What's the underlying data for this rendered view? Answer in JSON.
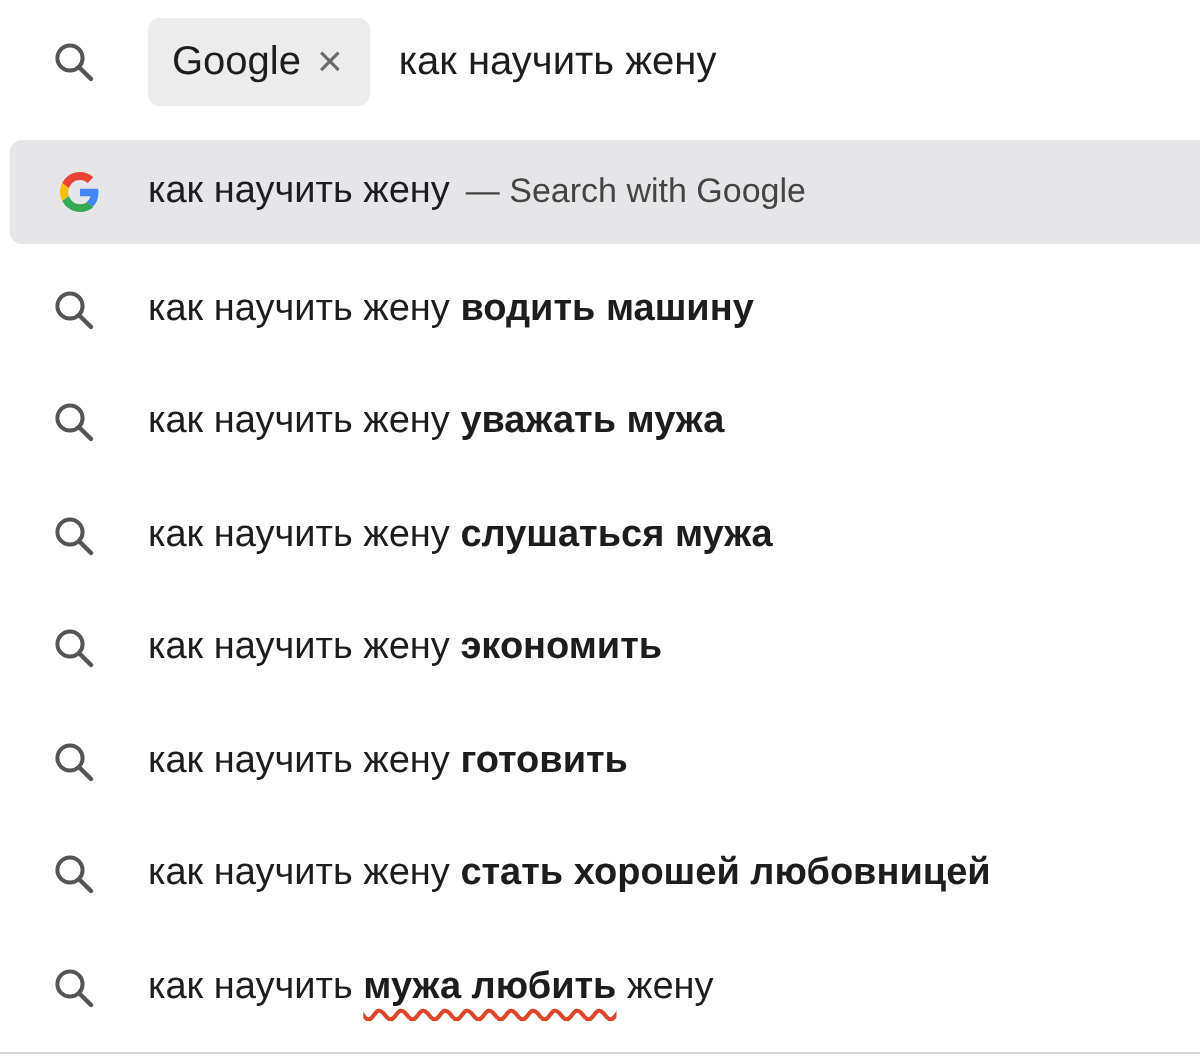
{
  "search_bar": {
    "engine_chip": {
      "label": "Google",
      "remove": "×"
    },
    "query": "как научить жену"
  },
  "suggestions": [
    {
      "kind": "engine",
      "selected": true,
      "parts": [
        {
          "text": "как научить жену",
          "bold": false,
          "misspelled": false
        }
      ],
      "suffix": "— Search with Google"
    },
    {
      "kind": "search",
      "selected": false,
      "parts": [
        {
          "text": "как научить жену ",
          "bold": false,
          "misspelled": false
        },
        {
          "text": "водить машину",
          "bold": true,
          "misspelled": false
        }
      ]
    },
    {
      "kind": "search",
      "selected": false,
      "parts": [
        {
          "text": "как научить жену ",
          "bold": false,
          "misspelled": false
        },
        {
          "text": "уважать мужа",
          "bold": true,
          "misspelled": false
        }
      ]
    },
    {
      "kind": "search",
      "selected": false,
      "parts": [
        {
          "text": "как научить жену ",
          "bold": false,
          "misspelled": false
        },
        {
          "text": "слушаться мужа",
          "bold": true,
          "misspelled": false
        }
      ]
    },
    {
      "kind": "search",
      "selected": false,
      "parts": [
        {
          "text": "как научить жену ",
          "bold": false,
          "misspelled": false
        },
        {
          "text": "экономить",
          "bold": true,
          "misspelled": false
        }
      ]
    },
    {
      "kind": "search",
      "selected": false,
      "parts": [
        {
          "text": "как научить жену ",
          "bold": false,
          "misspelled": false
        },
        {
          "text": "готовить",
          "bold": true,
          "misspelled": false
        }
      ]
    },
    {
      "kind": "search",
      "selected": false,
      "parts": [
        {
          "text": "как научить жену ",
          "bold": false,
          "misspelled": false
        },
        {
          "text": "стать хорошей любовницей",
          "bold": true,
          "misspelled": false
        }
      ]
    },
    {
      "kind": "search",
      "selected": false,
      "parts": [
        {
          "text": "как научить ",
          "bold": false,
          "misspelled": false
        },
        {
          "text": "мужа любить",
          "bold": true,
          "misspelled": true
        },
        {
          "text": " жену",
          "bold": false,
          "misspelled": false
        }
      ]
    }
  ]
}
